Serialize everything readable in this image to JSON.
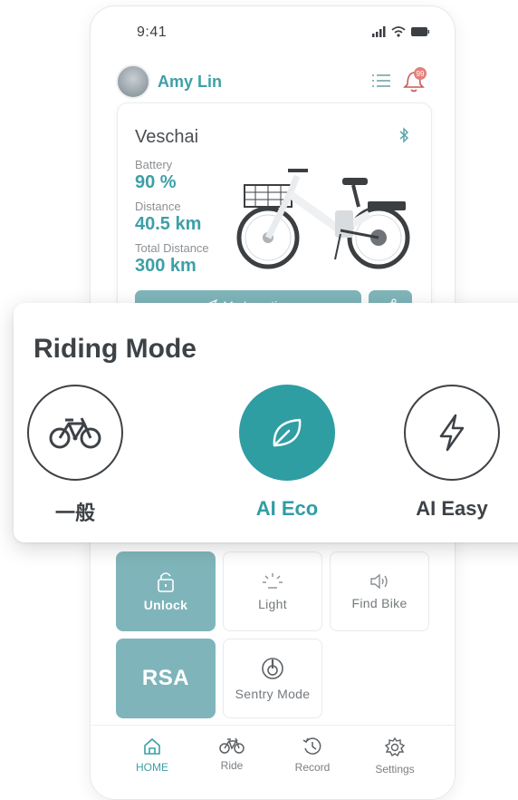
{
  "status": {
    "time": "9:41"
  },
  "user": {
    "name": "Amy Lin",
    "notification_count": "99"
  },
  "bike": {
    "name": "Veschai",
    "battery_label": "Battery",
    "battery_value": "90 %",
    "distance_label": "Distance",
    "distance_value": "40.5 km",
    "total_label": "Total Distance",
    "total_value": "300 km",
    "location_button": "My Location"
  },
  "riding_mode": {
    "title": "Riding Mode",
    "modes": [
      {
        "label": "一般",
        "icon": "bicycle-icon",
        "active": false
      },
      {
        "label": "AI Eco",
        "icon": "leaf-icon",
        "active": true
      },
      {
        "label": "AI Easy",
        "icon": "lightning-icon",
        "active": false
      }
    ]
  },
  "controls": {
    "unlock": "Unlock",
    "light": "Light",
    "find_bike": "Find Bike",
    "rsa": "RSA",
    "sentry": "Sentry Mode"
  },
  "tabs": [
    {
      "label": "HOME",
      "icon": "home-icon",
      "active": true
    },
    {
      "label": "Ride",
      "icon": "bicycle-icon",
      "active": false
    },
    {
      "label": "Record",
      "icon": "history-icon",
      "active": false
    },
    {
      "label": "Settings",
      "icon": "gear-icon",
      "active": false
    }
  ],
  "colors": {
    "accent": "#2f9ea3",
    "accent_soft": "#7fb5ba",
    "text_dark": "#3d4247"
  }
}
